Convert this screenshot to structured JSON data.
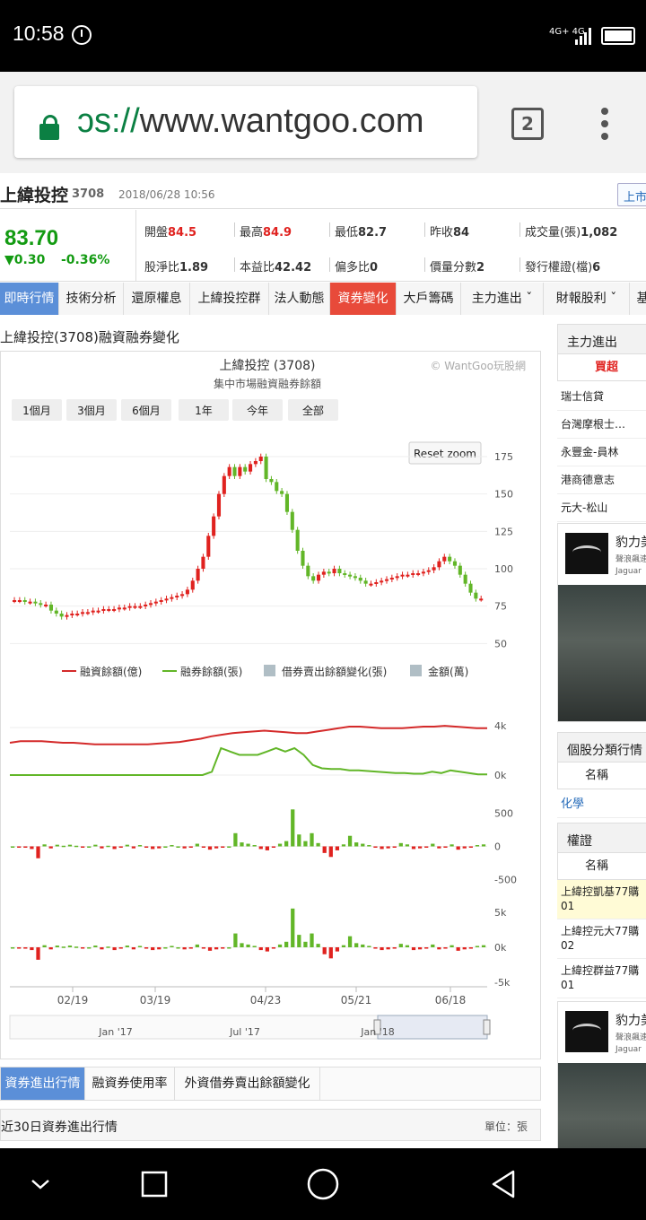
{
  "status_bar": {
    "time": "10:58",
    "network": "4G+ 4G"
  },
  "browser": {
    "url_scheme": "ɔs://",
    "url_host": "www.wantgoo.com",
    "tab_count": "2"
  },
  "stock": {
    "name": "上緯投控",
    "code": "3708",
    "datetime": "2018/06/28 10:56",
    "market_label": "上市",
    "price": "83.70",
    "change": "▼0.30",
    "change_pct": "-0.36%",
    "stats": [
      {
        "label": "開盤",
        "value": "84.5",
        "red": true
      },
      {
        "label": "最高",
        "value": "84.9",
        "red": true
      },
      {
        "label": "最低",
        "value": "82.7",
        "red": false
      },
      {
        "label": "昨收",
        "value": "84",
        "red": false
      },
      {
        "label": "成交量(張)",
        "value": "1,082",
        "red": false
      },
      {
        "label": "股淨比",
        "value": "1.89",
        "red": false
      },
      {
        "label": "本益比",
        "value": "42.42",
        "red": false
      },
      {
        "label": "偏多比",
        "value": "0",
        "red": false
      },
      {
        "label": "價量分數",
        "value": "2",
        "red": false
      },
      {
        "label": "發行權證(檔)",
        "value": "6",
        "red": false
      }
    ]
  },
  "nav_tabs": [
    "即時行情",
    "技術分析",
    "還原權息",
    "上緯投控群",
    "法人動態",
    "資券變化",
    "大戶籌碼",
    "主力進出 ˇ",
    "財報股利 ˇ",
    "基"
  ],
  "section_title": "上緯投控(3708)融資融券變化",
  "chart": {
    "watermark": "© WantGoo玩股網",
    "range_buttons": [
      "1個月",
      "3個月",
      "6個月",
      "1年",
      "今年",
      "全部"
    ],
    "reset_zoom": "Reset zoom"
  },
  "chart_data": {
    "type": "candlestick+line+bar",
    "title": "上緯投控 (3708)",
    "subtitle": "集中市場融資融券餘額",
    "x_ticks": [
      "02/19",
      "03/19",
      "04/23",
      "05/21",
      "06/18"
    ],
    "navigator_ticks": [
      "Jan '17",
      "Jul '17",
      "Jan '18"
    ],
    "price_axis": {
      "ticks": [
        175,
        150,
        125,
        100,
        75,
        50
      ],
      "ylim": [
        40,
        190
      ]
    },
    "balance_axis": {
      "ticks": [
        "4k",
        "0k"
      ]
    },
    "change_axis": {
      "ticks": [
        "500",
        "0",
        "-500"
      ],
      "ylim": [
        -700,
        700
      ]
    },
    "amount_axis": {
      "ticks": [
        "5k",
        "0k",
        "-5k"
      ],
      "ylim": [
        -7000,
        7000
      ]
    },
    "legend": [
      "融資餘額(億)",
      "融券餘額(張)",
      "借券賣出餘額變化(張)",
      "金額(萬)"
    ],
    "colors": {
      "up": "#e0221f",
      "down": "#62b628",
      "margin": "#d42a2a",
      "short": "#62b628",
      "lend": "#b0bec5",
      "amount": "#b0bec5"
    },
    "price_close": [
      79,
      79,
      78,
      78,
      77,
      76,
      76,
      72,
      70,
      68,
      69,
      70,
      70,
      71,
      71,
      72,
      72,
      73,
      73,
      73,
      74,
      74,
      75,
      75,
      75,
      76,
      77,
      78,
      79,
      80,
      81,
      82,
      83,
      86,
      92,
      100,
      108,
      122,
      135,
      150,
      162,
      168,
      162,
      168,
      165,
      170,
      172,
      175,
      160,
      158,
      152,
      150,
      138,
      126,
      112,
      102,
      95,
      92,
      96,
      98,
      97,
      100,
      97,
      96,
      95,
      94,
      92,
      90,
      90,
      91,
      92,
      93,
      94,
      95,
      96,
      96,
      97,
      97,
      98,
      99,
      101,
      105,
      108,
      105,
      102,
      96,
      90,
      84,
      80,
      80
    ],
    "margin_balance": [
      60,
      62,
      62,
      62,
      61,
      60,
      60,
      59,
      58,
      58,
      58,
      58,
      58,
      58,
      59,
      60,
      61,
      63,
      65,
      68,
      70,
      72,
      73,
      74,
      75,
      74,
      73,
      72,
      72,
      74,
      76,
      78,
      80,
      80,
      79,
      78,
      78,
      78,
      79,
      80,
      80,
      81,
      80,
      79,
      78,
      78
    ],
    "short_balance": [
      5,
      5,
      5,
      5,
      5,
      5,
      5,
      5,
      5,
      5,
      5,
      5,
      5,
      5,
      5,
      5,
      5,
      5,
      5,
      5,
      5,
      5,
      10,
      45,
      40,
      35,
      35,
      35,
      40,
      45,
      40,
      45,
      35,
      20,
      15,
      14,
      14,
      12,
      12,
      11,
      10,
      9,
      8,
      8,
      7,
      7,
      10,
      8,
      12,
      10,
      8,
      6,
      6
    ],
    "lend_change": [
      0,
      -20,
      -20,
      -40,
      -180,
      30,
      -30,
      25,
      10,
      25,
      10,
      -10,
      0,
      25,
      -30,
      10,
      -40,
      -20,
      25,
      -30,
      20,
      -20,
      -40,
      -30,
      0,
      20,
      0,
      -30,
      -20,
      40,
      -20,
      -50,
      -30,
      -20,
      0,
      200,
      60,
      40,
      20,
      -40,
      -60,
      -20,
      40,
      80,
      560,
      180,
      80,
      200,
      50,
      -100,
      -160,
      -60,
      30,
      160,
      60,
      40,
      20,
      -20,
      -40,
      -30,
      -20,
      50,
      30,
      -40,
      -30,
      -20,
      40,
      -30,
      -20,
      30,
      -50,
      -30,
      -20,
      20,
      30
    ]
  },
  "sub_tabs": [
    "資券進出行情",
    "融資券使用率",
    "外資借券賣出餘額變化"
  ],
  "table": {
    "title": "近30日資券進出行情",
    "unit": "單位：張"
  },
  "sidebar": {
    "main_force": {
      "title": "主力進出",
      "buy_label": "買超",
      "brokers": [
        "瑞士信貸",
        "台灣摩根士…",
        "永豐金-員林",
        "港商德意志",
        "元大-松山"
      ]
    },
    "ad": {
      "title": "豹力美",
      "line1": "聲浪飆速",
      "line2": "Jaguar"
    },
    "category": {
      "title": "個股分類行情",
      "col_label": "名稱",
      "item": "化學"
    },
    "warrants": {
      "title": "權證",
      "col_label": "名稱",
      "items": [
        "上緯控凱基77購01",
        "上緯控元大77購02",
        "上緯控群益77購01"
      ]
    }
  }
}
